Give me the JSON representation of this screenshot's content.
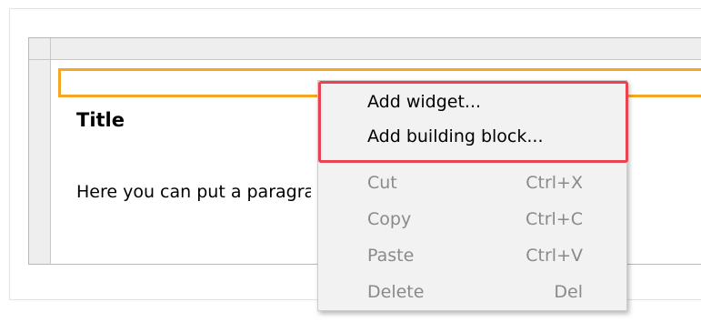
{
  "document": {
    "title": "Title",
    "paragraph": "Here you can put a paragraph of text."
  },
  "context_menu": {
    "items": [
      {
        "label": "Add widget...",
        "shortcut": "",
        "enabled": true
      },
      {
        "label": "Add building block...",
        "shortcut": "",
        "enabled": true
      },
      {
        "label": "Cut",
        "shortcut": "Ctrl+X",
        "enabled": false
      },
      {
        "label": "Copy",
        "shortcut": "Ctrl+C",
        "enabled": false
      },
      {
        "label": "Paste",
        "shortcut": "Ctrl+V",
        "enabled": false
      },
      {
        "label": "Delete",
        "shortcut": "Del",
        "enabled": false
      }
    ]
  },
  "colors": {
    "selection_border": "#f5a623",
    "highlight_border": "#e8434f",
    "menu_background": "#f2f2f2",
    "disabled_text": "#8a8a8a"
  }
}
